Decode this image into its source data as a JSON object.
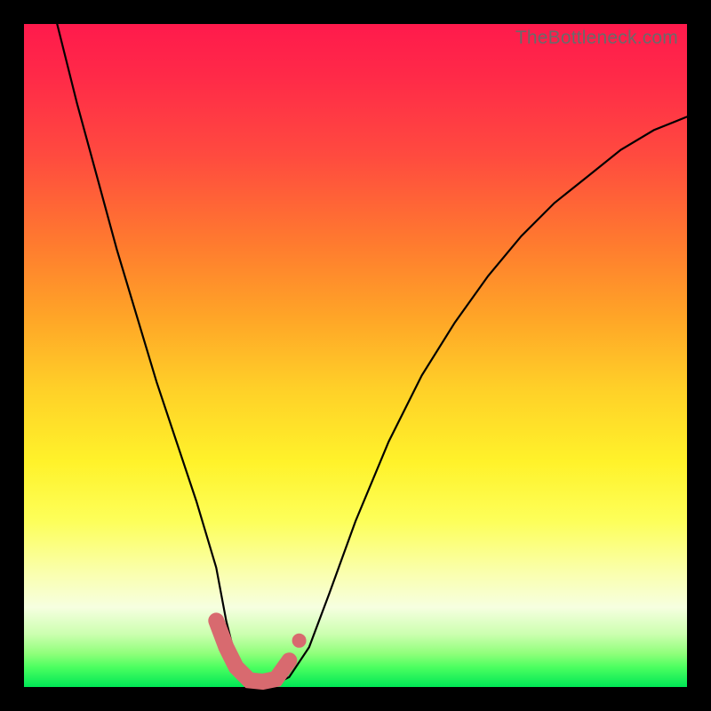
{
  "watermark": "TheBottleneck.com",
  "colors": {
    "gradient_top": "#ff1a4c",
    "gradient_mid": "#fff22a",
    "gradient_bottom": "#00e756",
    "curve": "#000000",
    "highlight": "#d86a6f",
    "background": "#000000"
  },
  "chart_data": {
    "type": "line",
    "title": "",
    "xlabel": "",
    "ylabel": "",
    "xlim": [
      0,
      100
    ],
    "ylim": [
      0,
      100
    ],
    "grid": false,
    "note": "No axes, ticks, or labels rendered. Values estimated from pixel positions; y=0 at bottom, y=100 at top.",
    "series": [
      {
        "name": "curve",
        "x": [
          5,
          8,
          11,
          14,
          17,
          20,
          23,
          26,
          29,
          30.5,
          32,
          34,
          36,
          38,
          40,
          43,
          46,
          50,
          55,
          60,
          65,
          70,
          75,
          80,
          85,
          90,
          95,
          100
        ],
        "y": [
          100,
          88,
          77,
          66,
          56,
          46,
          37,
          28,
          18,
          10,
          4,
          1,
          0.5,
          0.5,
          1.5,
          6,
          14,
          25,
          37,
          47,
          55,
          62,
          68,
          73,
          77,
          81,
          84,
          86
        ]
      }
    ],
    "highlight_segment": {
      "name": "valley-overlay",
      "style": "thick-pink",
      "x": [
        29,
        30.5,
        32,
        34,
        36,
        38,
        40
      ],
      "y": [
        10,
        6,
        3,
        1,
        0.8,
        1.2,
        4
      ]
    },
    "extra_point": {
      "x": 41.5,
      "y": 7
    }
  }
}
